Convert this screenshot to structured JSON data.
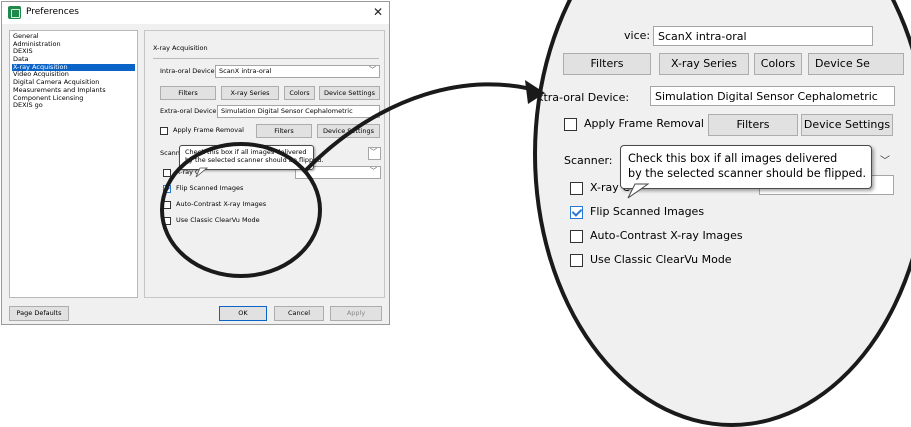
{
  "window": {
    "title": "Preferences",
    "icon": "app-icon",
    "close_icon": "close-icon"
  },
  "sidebar": {
    "items": [
      {
        "label": "General",
        "selected": false
      },
      {
        "label": "Administration",
        "selected": false
      },
      {
        "label": "DEXIS",
        "selected": false
      },
      {
        "label": "Data",
        "selected": false
      },
      {
        "label": "X-ray Acquisition",
        "selected": true
      },
      {
        "label": "Video Acquisition",
        "selected": false
      },
      {
        "label": "Digital Camera Acquisition",
        "selected": false
      },
      {
        "label": "Measurements and Implants",
        "selected": false
      },
      {
        "label": "Component Licensing",
        "selected": false
      },
      {
        "label": "DEXIS go",
        "selected": false
      }
    ]
  },
  "panel": {
    "heading": "X-ray Acquisition",
    "intraoral": {
      "label": "Intra-oral Device:",
      "value": "ScanX intra-oral",
      "buttons": {
        "filters": "Filters",
        "xray_series": "X-ray Series",
        "colors": "Colors",
        "device_settings": "Device Settings"
      }
    },
    "extraoral": {
      "label": "Extra-oral Device:",
      "value": "Simulation Digital Sensor Cephalometric"
    },
    "frame_removal": {
      "label": "Apply Frame Removal",
      "checked": false,
      "buttons": {
        "filters": "Filters",
        "device_settings": "Device Settings"
      }
    },
    "scanner": {
      "label": "Scanner:"
    },
    "options": [
      {
        "label": "X-ray C",
        "checked": false
      },
      {
        "label": "Flip Scanned Images",
        "checked": true
      },
      {
        "label": "Auto-Contrast X-ray Images",
        "checked": false
      },
      {
        "label": "Use Classic ClearVu Mode",
        "checked": false
      }
    ],
    "tooltip": {
      "line1": "Check this box if all images delivered",
      "line2": "by the selected scanner should be flipped."
    }
  },
  "footer": {
    "page_defaults": "Page Defaults",
    "ok": "OK",
    "cancel": "Cancel",
    "apply": "Apply"
  },
  "zoom": {
    "device_label_fragment": "vice:",
    "device_value": "ScanX intra-oral",
    "device_settings_fragment": "Device Se"
  },
  "colors": {
    "selection": "#0a64c8",
    "checkbox_accent": "#2b78d4",
    "annotation": "#1a1a1a"
  }
}
